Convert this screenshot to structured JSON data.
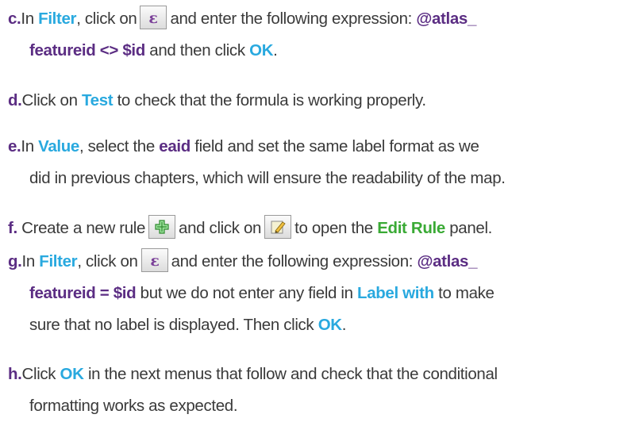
{
  "steps": {
    "c": {
      "letter": "c.",
      "t1": "In ",
      "filter": "Filter",
      "t2": ", click on",
      "t3": "and enter the following expression: ",
      "expr_a": "@atlas_",
      "expr_b": "featureid <> $id",
      "t4": " and then click ",
      "ok": "OK",
      "t5": "."
    },
    "d": {
      "letter": "d.",
      "t1": "Click on ",
      "test": "Test",
      "t2": " to check that the formula is working properly."
    },
    "e": {
      "letter": "e.",
      "t1": "In ",
      "value": "Value",
      "t2": ", select the ",
      "eaid": "eaid",
      "t3": " field and set the same label format as we",
      "t4": "did in previous chapters, which will ensure the readability of the map."
    },
    "f": {
      "letter": "f.",
      "t1": " Create a new rule",
      "t2": "and click on",
      "t3": "to open the ",
      "edit_rule": "Edit Rule",
      "t4": " panel."
    },
    "g": {
      "letter": "g.",
      "t1": "In ",
      "filter": "Filter",
      "t2": ", click on",
      "t3": "and enter the following expression: ",
      "expr_a": "@atlas_",
      "expr_b": "featureid = $id",
      "t4": " but we do not enter any field in ",
      "label_with": "Label with",
      "t5": " to make",
      "t6": "sure that no label is displayed. Then click ",
      "ok": "OK",
      "t7": "."
    },
    "h": {
      "letter": "h.",
      "t1": "Click ",
      "ok": "OK",
      "t2": " in the next menus that follow and check that the conditional",
      "t3": "formatting works as expected."
    }
  },
  "icons": {
    "expression": "expression-epsilon-icon",
    "add_rule": "add-rule-plus-icon",
    "edit_rule": "edit-rule-pencil-icon"
  }
}
